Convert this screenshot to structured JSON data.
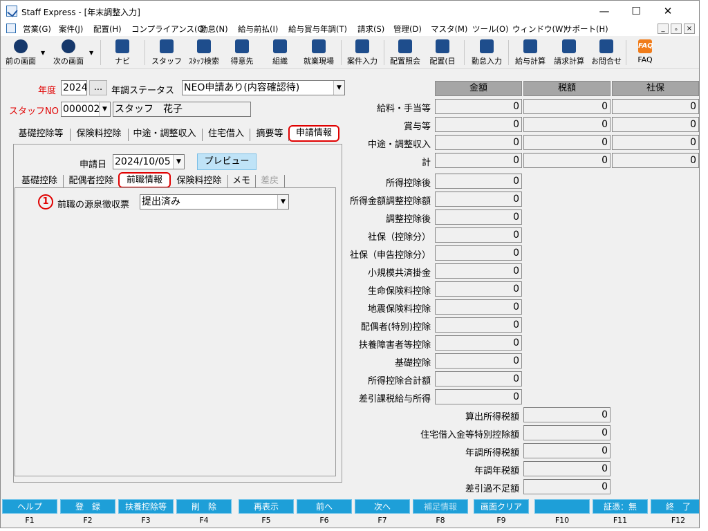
{
  "window": {
    "title": "Staff Express - [年末調整入力]",
    "min": "—",
    "max": "☐",
    "close": "✕"
  },
  "menu": [
    "営業(G)",
    "案件(J)",
    "配置(H)",
    "コンプライアンス(C)",
    "勤怠(N)",
    "給与前払(I)",
    "給与賞与年調(T)",
    "請求(S)",
    "管理(D)",
    "マスタ(M)",
    "ツール(O)",
    "ウィンドウ(W)",
    "サポート(H)"
  ],
  "mdi_controls": [
    "_",
    "ₒ",
    "×"
  ],
  "toolbar": {
    "back": "前の画面",
    "next": "次の画面",
    "navi": "ナビ",
    "staff": "スタッフ",
    "staff_search": "ｽﾀｯﾌ検索",
    "client": "得意先",
    "org": "組織",
    "site": "就業現場",
    "case_input": "案件入力",
    "assign_query": "配置照会",
    "assign_day": "配置(日",
    "attend_input": "勤怠入力",
    "salary_calc": "給与計算",
    "bill_calc": "請求計算",
    "inquiry": "お問合せ",
    "faq": "FAQ",
    "faq_icon": "FAQ"
  },
  "form": {
    "year_label": "年度",
    "year": "2024",
    "dots": "...",
    "status_label": "年調ステータス",
    "status": "NEO申請あり(内容確認待)",
    "staff_label": "スタッフNO",
    "staff_no": "000002",
    "staff_name": "スタッフ　花子"
  },
  "tabs": [
    "基礎控除等",
    "保険料控除",
    "中途・調整収入",
    "住宅借入",
    "摘要等",
    "申請情報"
  ],
  "apply": {
    "date_label": "申請日",
    "date": "2024/10/05",
    "preview": "プレビュー"
  },
  "subtabs": [
    "基礎控除",
    "配偶者控除",
    "前職情報",
    "保険料控除",
    "メモ",
    "差戻"
  ],
  "prev_job": {
    "marker": "1",
    "label": "前職の源泉徴収票",
    "value": "提出済み"
  },
  "columns": [
    "金額",
    "税額",
    "社保"
  ],
  "rows3": [
    {
      "label": "給料・手当等",
      "v": [
        "0",
        "0",
        "0"
      ]
    },
    {
      "label": "賞与等",
      "v": [
        "0",
        "0",
        "0"
      ]
    },
    {
      "label": "中途・調整収入",
      "v": [
        "0",
        "0",
        "0"
      ]
    },
    {
      "label": "計",
      "v": [
        "0",
        "0",
        "0"
      ]
    }
  ],
  "rows1": [
    {
      "label": "所得控除後",
      "v": "0"
    },
    {
      "label": "所得金額調整控除額",
      "v": "0"
    },
    {
      "label": "調整控除後",
      "v": "0"
    },
    {
      "label": "社保（控除分）",
      "v": "0"
    },
    {
      "label": "社保（申告控除分）",
      "v": "0"
    },
    {
      "label": "小規模共済掛金",
      "v": "0"
    },
    {
      "label": "生命保険料控除",
      "v": "0"
    },
    {
      "label": "地震保険料控除",
      "v": "0"
    },
    {
      "label": "配偶者(特別)控除",
      "v": "0"
    },
    {
      "label": "扶養障害者等控除",
      "v": "0"
    },
    {
      "label": "基礎控除",
      "v": "0"
    },
    {
      "label": "所得控除合計額",
      "v": "0"
    },
    {
      "label": "差引課税給与所得",
      "v": "0"
    }
  ],
  "rowsTax": [
    {
      "label": "算出所得税額",
      "v": "0"
    },
    {
      "label": "住宅借入金等特別控除額",
      "v": "0"
    },
    {
      "label": "年調所得税額",
      "v": "0"
    },
    {
      "label": "年調年税額",
      "v": "0"
    },
    {
      "label": "差引過不足額",
      "v": "0"
    }
  ],
  "fkeys": [
    {
      "label": "ヘルプ",
      "key": "F1"
    },
    {
      "label": "登　録",
      "key": "F2"
    },
    {
      "label": "扶養控除等",
      "key": "F3"
    },
    {
      "label": "削　除",
      "key": "F4"
    },
    {
      "label": "再表示",
      "key": "F5"
    },
    {
      "label": "前へ",
      "key": "F6"
    },
    {
      "label": "次へ",
      "key": "F7"
    },
    {
      "label": "補足情報",
      "key": "F8"
    },
    {
      "label": "画面クリア",
      "key": "F9"
    },
    {
      "label": "",
      "key": "F10"
    },
    {
      "label": "証憑：無",
      "key": "F11"
    },
    {
      "label": "終　了",
      "key": "F12"
    }
  ]
}
